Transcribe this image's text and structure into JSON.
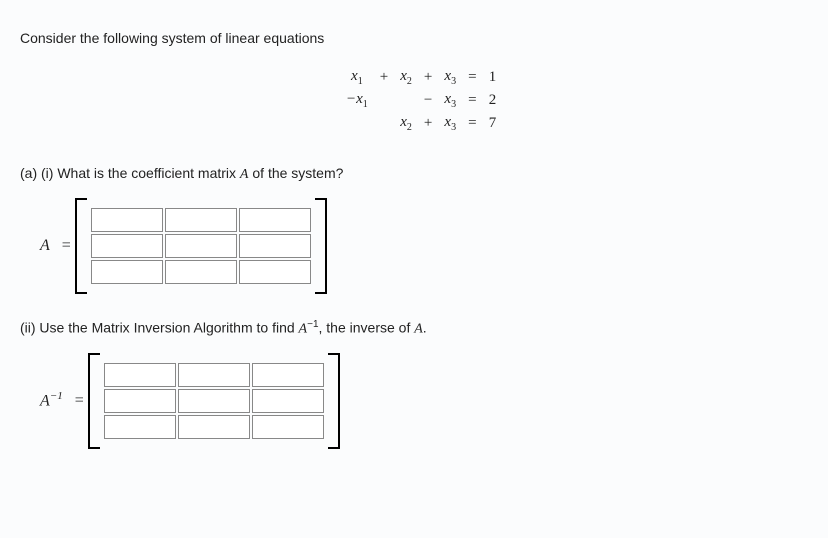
{
  "intro": "Consider the following system of linear equations",
  "system": {
    "r1": {
      "c1": "x",
      "s1": "1",
      "op1": "+",
      "c2": "x",
      "s2": "2",
      "op2": "+",
      "c3": "x",
      "s3": "3",
      "eq": "=",
      "rhs": "1"
    },
    "r2": {
      "c1": "−x",
      "s1": "1",
      "op1": "",
      "c2": "",
      "s2": "",
      "op2": "−",
      "c3": "x",
      "s3": "3",
      "eq": "=",
      "rhs": "2"
    },
    "r3": {
      "c1": "",
      "s1": "",
      "op1": "",
      "c2": "x",
      "s2": "2",
      "op2": "+",
      "c3": "x",
      "s3": "3",
      "eq": "=",
      "rhs": "7"
    }
  },
  "qA": {
    "prefix": "(a) (i) What is the coefficient matrix ",
    "mat": "A",
    "suffix": " of the system?"
  },
  "labelA": "A",
  "qB": {
    "prefix": "(ii) Use the Matrix Inversion Algorithm to find ",
    "mat": "A",
    "exp": "−1",
    "mid": ", the inverse of ",
    "mat2": "A",
    "suffix": "."
  },
  "labelAinv": "A",
  "labelAinvExp": "−1"
}
